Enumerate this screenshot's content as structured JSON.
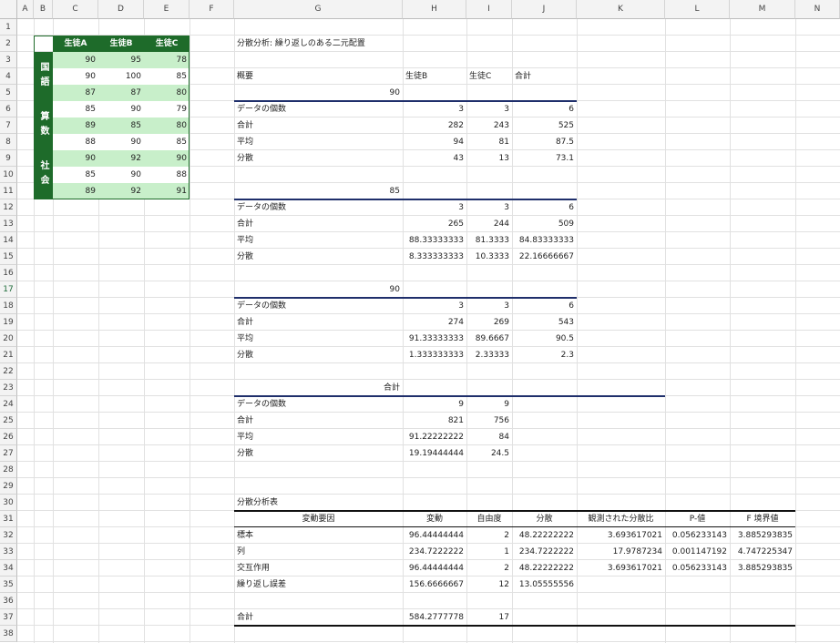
{
  "columns": [
    "A",
    "B",
    "C",
    "D",
    "E",
    "F",
    "G",
    "H",
    "I",
    "J",
    "K",
    "L",
    "M",
    "N"
  ],
  "rows": [
    "1",
    "2",
    "3",
    "4",
    "5",
    "6",
    "7",
    "8",
    "9",
    "10",
    "11",
    "12",
    "13",
    "14",
    "15",
    "16",
    "17",
    "18",
    "19",
    "20",
    "21",
    "22",
    "23",
    "24",
    "25",
    "26",
    "27",
    "28",
    "29",
    "30",
    "31",
    "32",
    "33",
    "34",
    "35",
    "36",
    "37",
    "38"
  ],
  "input_table": {
    "headers": [
      "生徒A",
      "生徒B",
      "生徒C"
    ],
    "subjects": [
      "国語",
      "算数",
      "社会"
    ],
    "values": [
      [
        "90",
        "95",
        "78"
      ],
      [
        "90",
        "100",
        "85"
      ],
      [
        "87",
        "87",
        "80"
      ],
      [
        "85",
        "90",
        "79"
      ],
      [
        "89",
        "85",
        "80"
      ],
      [
        "88",
        "90",
        "85"
      ],
      [
        "90",
        "92",
        "90"
      ],
      [
        "85",
        "90",
        "88"
      ],
      [
        "89",
        "92",
        "91"
      ]
    ]
  },
  "anova": {
    "title": "分散分析: 繰り返しのある二元配置",
    "summary_header": [
      "概要",
      "生徒B",
      "生徒C",
      "合計"
    ],
    "groups": [
      {
        "label": "90",
        "rows": [
          [
            "データの個数",
            "3",
            "3",
            "6"
          ],
          [
            "合計",
            "282",
            "243",
            "525"
          ],
          [
            "平均",
            "94",
            "81",
            "87.5"
          ],
          [
            "分散",
            "43",
            "13",
            "73.1"
          ]
        ]
      },
      {
        "label": "85",
        "rows": [
          [
            "データの個数",
            "3",
            "3",
            "6"
          ],
          [
            "合計",
            "265",
            "244",
            "509"
          ],
          [
            "平均",
            "88.33333333",
            "81.3333",
            "84.83333333"
          ],
          [
            "分散",
            "8.333333333",
            "10.3333",
            "22.16666667"
          ]
        ]
      },
      {
        "label": "90",
        "rows": [
          [
            "データの個数",
            "3",
            "3",
            "6"
          ],
          [
            "合計",
            "274",
            "269",
            "543"
          ],
          [
            "平均",
            "91.33333333",
            "89.6667",
            "90.5"
          ],
          [
            "分散",
            "1.333333333",
            "2.33333",
            "2.3"
          ]
        ]
      }
    ],
    "total_group": {
      "label": "合計",
      "rows": [
        [
          "データの個数",
          "9",
          "9"
        ],
        [
          "合計",
          "821",
          "756"
        ],
        [
          "平均",
          "91.22222222",
          "84"
        ],
        [
          "分散",
          "19.19444444",
          "24.5"
        ]
      ]
    },
    "table_title": "分散分析表",
    "table_header": [
      "変動要因",
      "変動",
      "自由度",
      "分散",
      "観測された分散比",
      "P-値",
      "F 境界値"
    ],
    "table_rows": [
      [
        "標本",
        "96.44444444",
        "2",
        "48.22222222",
        "3.693617021",
        "0.056233143",
        "3.885293835"
      ],
      [
        "列",
        "234.7222222",
        "1",
        "234.7222222",
        "17.9787234",
        "0.001147192",
        "4.747225347"
      ],
      [
        "交互作用",
        "96.44444444",
        "2",
        "48.22222222",
        "3.693617021",
        "0.056233143",
        "3.885293835"
      ],
      [
        "繰り返し誤差",
        "156.6666667",
        "12",
        "13.05555556",
        "",
        "",
        ""
      ]
    ],
    "table_total": [
      "合計",
      "584.2777778",
      "17"
    ]
  }
}
